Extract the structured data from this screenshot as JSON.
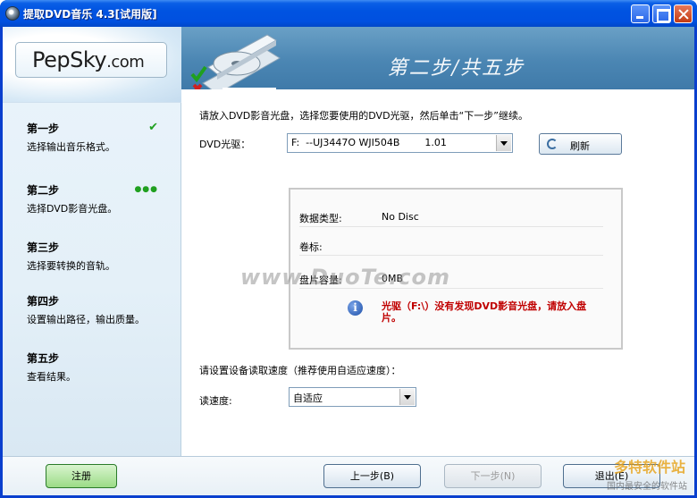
{
  "window": {
    "title": "提取DVD音乐 4.3[试用版]",
    "controls": {
      "minimize": "minimize-icon",
      "maximize": "maximize-icon",
      "close": "close-icon"
    }
  },
  "logo": {
    "text": "PepSky",
    "suffix": ".com"
  },
  "header": {
    "step_text": "第二步/共五步"
  },
  "steps": [
    {
      "title": "第一步",
      "desc": "选择输出音乐格式。",
      "status": "✔"
    },
    {
      "title": "第二步",
      "desc": "选择DVD影音光盘。",
      "status": "●●●"
    },
    {
      "title": "第三步",
      "desc": "选择要转换的音轨。",
      "status": ""
    },
    {
      "title": "第四步",
      "desc": "设置输出路径，输出质量。",
      "status": ""
    },
    {
      "title": "第五步",
      "desc": "查看结果。",
      "status": ""
    }
  ],
  "main": {
    "instruction": "请放入DVD影音光盘，选择您要使用的DVD光驱，然后单击“下一步”继续。",
    "drive_label": "DVD光驱：",
    "drive_value": "F:  --UJ3447O WJI504B        1.01",
    "refresh_label": "刷新",
    "info": {
      "data_type_label": "数据类型:",
      "data_type_value": "No Disc",
      "volume_label": "卷标:",
      "volume_value": "",
      "capacity_label": "盘片容量:",
      "capacity_value": "0MB"
    },
    "warning": "光驱（F:\\）没有发现DVD影音光盘，请放入盘片。",
    "speed_prompt": "请设置设备读取速度（推荐使用自适应速度）：",
    "speed_label": "读速度:",
    "speed_value": "自适应"
  },
  "watermark": "www.DuoTe.com",
  "footer": {
    "register": "注册",
    "prev": "上一步(B)",
    "next": "下一步(N)",
    "exit": "退出(E)",
    "corner_brand": "多特软件站",
    "corner_sub": "国内最安全的软件站"
  }
}
